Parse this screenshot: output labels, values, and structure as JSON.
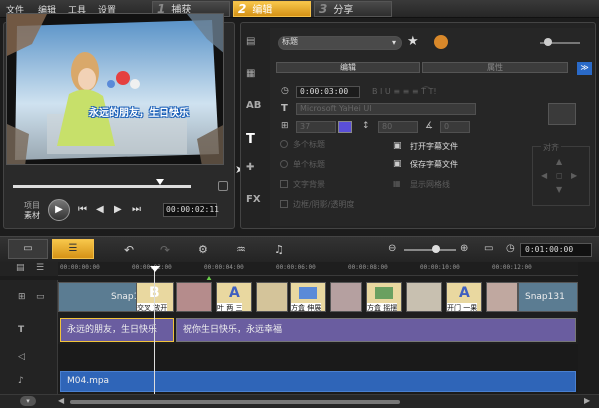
{
  "menu": {
    "items": [
      "文件",
      "编辑",
      "工具",
      "设置"
    ]
  },
  "steps": [
    {
      "num": "1",
      "label": "捕获",
      "active": false
    },
    {
      "num": "2",
      "label": "编辑",
      "active": true
    },
    {
      "num": "3",
      "label": "分享",
      "active": false
    }
  ],
  "preview": {
    "overlay_text": "永远的朋友，生日快乐",
    "mode_project": "项目",
    "mode_clip": "素材",
    "timecode": "00:00:02:11"
  },
  "options": {
    "title_select": "标题",
    "tab_edit": "编辑",
    "tab_attr": "属性",
    "duration": "0:00:03:00",
    "font": "Microsoft YaHei UI",
    "font_size": "37",
    "line_spacing": "80",
    "angle": "0",
    "open_subtitle": "打开字幕文件",
    "save_subtitle": "保存字幕文件",
    "multi_title": "多个标题",
    "single_title": "单个标题",
    "text_bg": "文字背景",
    "display_speed": "显示网格线",
    "border_shadow": "边框/阴影/透明度",
    "align_label": "对齐",
    "accent_color": "#5a4fd8"
  },
  "timeline": {
    "timecode": "0:01:00:00",
    "ruler": [
      "00:00:00:00",
      "00:00:02:00",
      "00:00:04:00",
      "00:00:06:00",
      "00:00:08:00",
      "00:00:10:00",
      "00:00:12:00"
    ],
    "video_clips": [
      "Snap1",
      "交叉 放开",
      "",
      "叶 两 三",
      "方盒 伸展",
      "",
      "方盒 摇摆",
      "",
      "开门 一果",
      "",
      "Snap131"
    ],
    "title1": "永远的朋友，生日快乐",
    "title2": "祝你生日快乐，永远幸福",
    "music": "M04.mpa"
  }
}
